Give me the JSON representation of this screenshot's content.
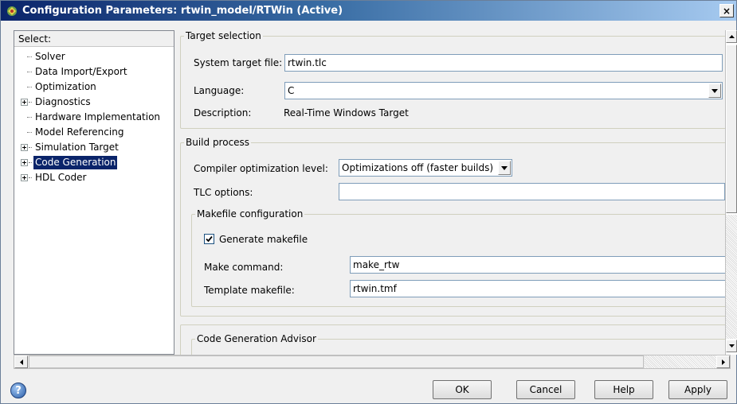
{
  "window": {
    "title": "Configuration Parameters: rtwin_model/RTWin (Active)",
    "close_glyph": "×"
  },
  "tree": {
    "header": "Select:",
    "items": [
      {
        "label": "Solver",
        "expandable": false,
        "selected": false
      },
      {
        "label": "Data Import/Export",
        "expandable": false,
        "selected": false
      },
      {
        "label": "Optimization",
        "expandable": false,
        "selected": false
      },
      {
        "label": "Diagnostics",
        "expandable": true,
        "selected": false
      },
      {
        "label": "Hardware Implementation",
        "expandable": false,
        "selected": false
      },
      {
        "label": "Model Referencing",
        "expandable": false,
        "selected": false
      },
      {
        "label": "Simulation Target",
        "expandable": true,
        "selected": false
      },
      {
        "label": "Code Generation",
        "expandable": true,
        "selected": true
      },
      {
        "label": "HDL Coder",
        "expandable": true,
        "selected": false
      }
    ]
  },
  "target_selection": {
    "legend": "Target selection",
    "system_target_file_label": "System target file:",
    "system_target_file_value": "rtwin.tlc",
    "language_label": "Language:",
    "language_value": "C",
    "description_label": "Description:",
    "description_value": "Real-Time Windows Target"
  },
  "build_process": {
    "legend": "Build process",
    "compiler_opt_label": "Compiler optimization level:",
    "compiler_opt_value": "Optimizations off (faster builds)",
    "tlc_options_label": "TLC options:",
    "tlc_options_value": "",
    "makefile": {
      "legend": "Makefile configuration",
      "generate_makefile_label": "Generate makefile",
      "generate_makefile_checked": true,
      "make_command_label": "Make command:",
      "make_command_value": "make_rtw",
      "template_makefile_label": "Template makefile:",
      "template_makefile_value": "rtwin.tmf"
    }
  },
  "advisor": {
    "legend": "Code Generation Advisor"
  },
  "buttons": {
    "ok": "OK",
    "cancel": "Cancel",
    "help": "Help",
    "apply": "Apply"
  },
  "help_icon_glyph": "?",
  "colors": {
    "title_bar_start": "#0a246a",
    "selection": "#0a246a"
  }
}
